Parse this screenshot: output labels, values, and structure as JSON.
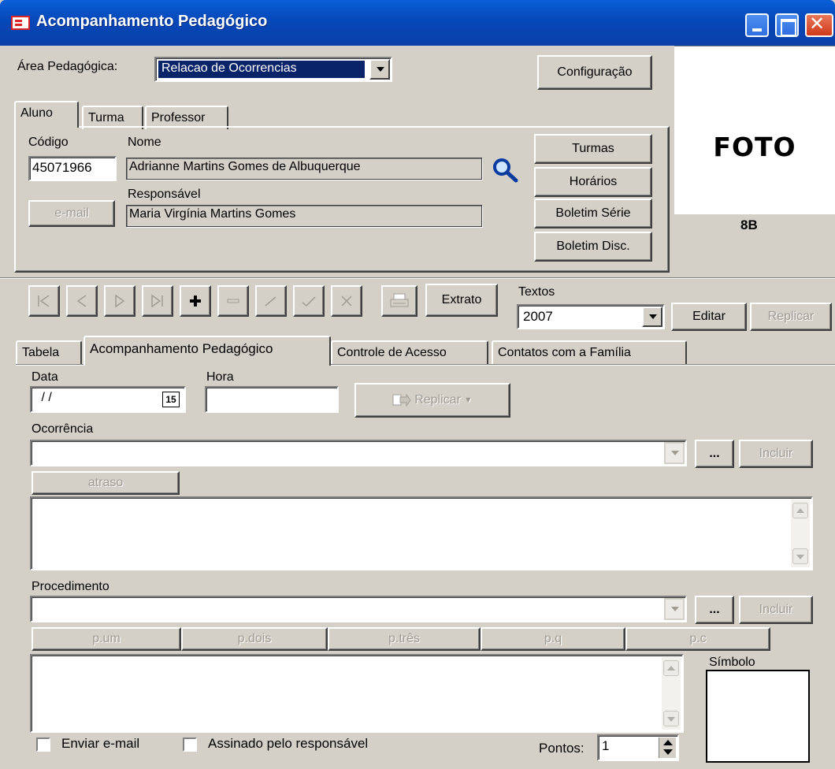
{
  "window": {
    "title": "Acompanhamento Pedagógico"
  },
  "top": {
    "area_label": "Área Pedagógica:",
    "area_value": "Relacao de Ocorrencias",
    "config_button": "Configuração"
  },
  "student_tabs": [
    "Aluno",
    "Turma",
    "Professor"
  ],
  "student": {
    "codigo_label": "Código",
    "codigo_value": "45071966",
    "nome_label": "Nome",
    "nome_value": "Adrianne Martins Gomes de Albuquerque",
    "responsavel_label": "Responsável",
    "responsavel_value": "Maria Virgínia Martins Gomes",
    "email_button": "e-mail"
  },
  "side_buttons": [
    "Turmas",
    "Horários",
    "Boletim Série",
    "Boletim Disc."
  ],
  "photo": {
    "text": "FOTO",
    "class_label": "8B"
  },
  "toolbar": {
    "extrato_button": "Extrato",
    "textos_label": "Textos",
    "textos_value": "2007",
    "editar_button": "Editar",
    "replicar_button": "Replicar"
  },
  "main_tabs": [
    "Tabela",
    "Acompanhamento Pedagógico",
    "Controle de Acesso",
    "Contatos com a Família"
  ],
  "form": {
    "data_label": "Data",
    "data_value": " / /",
    "calendar_day": "15",
    "hora_label": "Hora",
    "hora_value": "",
    "replicar_button": "Replicar",
    "ocorrencia_label": "Ocorrência",
    "ocorrencia_value": "",
    "ellipsis": "...",
    "incluir_button": "Incluir",
    "atraso_button": "atraso",
    "procedimento_label": "Procedimento",
    "procedimento_value": "",
    "proc_buttons": [
      "p.um",
      "p.dois",
      "p.três",
      "p.q",
      "p.c"
    ],
    "simbolo_label": "Símbolo",
    "enviar_email_label": "Enviar e-mail",
    "assinado_label": "Assinado pelo responsável",
    "pontos_label": "Pontos:",
    "pontos_value": "1"
  }
}
